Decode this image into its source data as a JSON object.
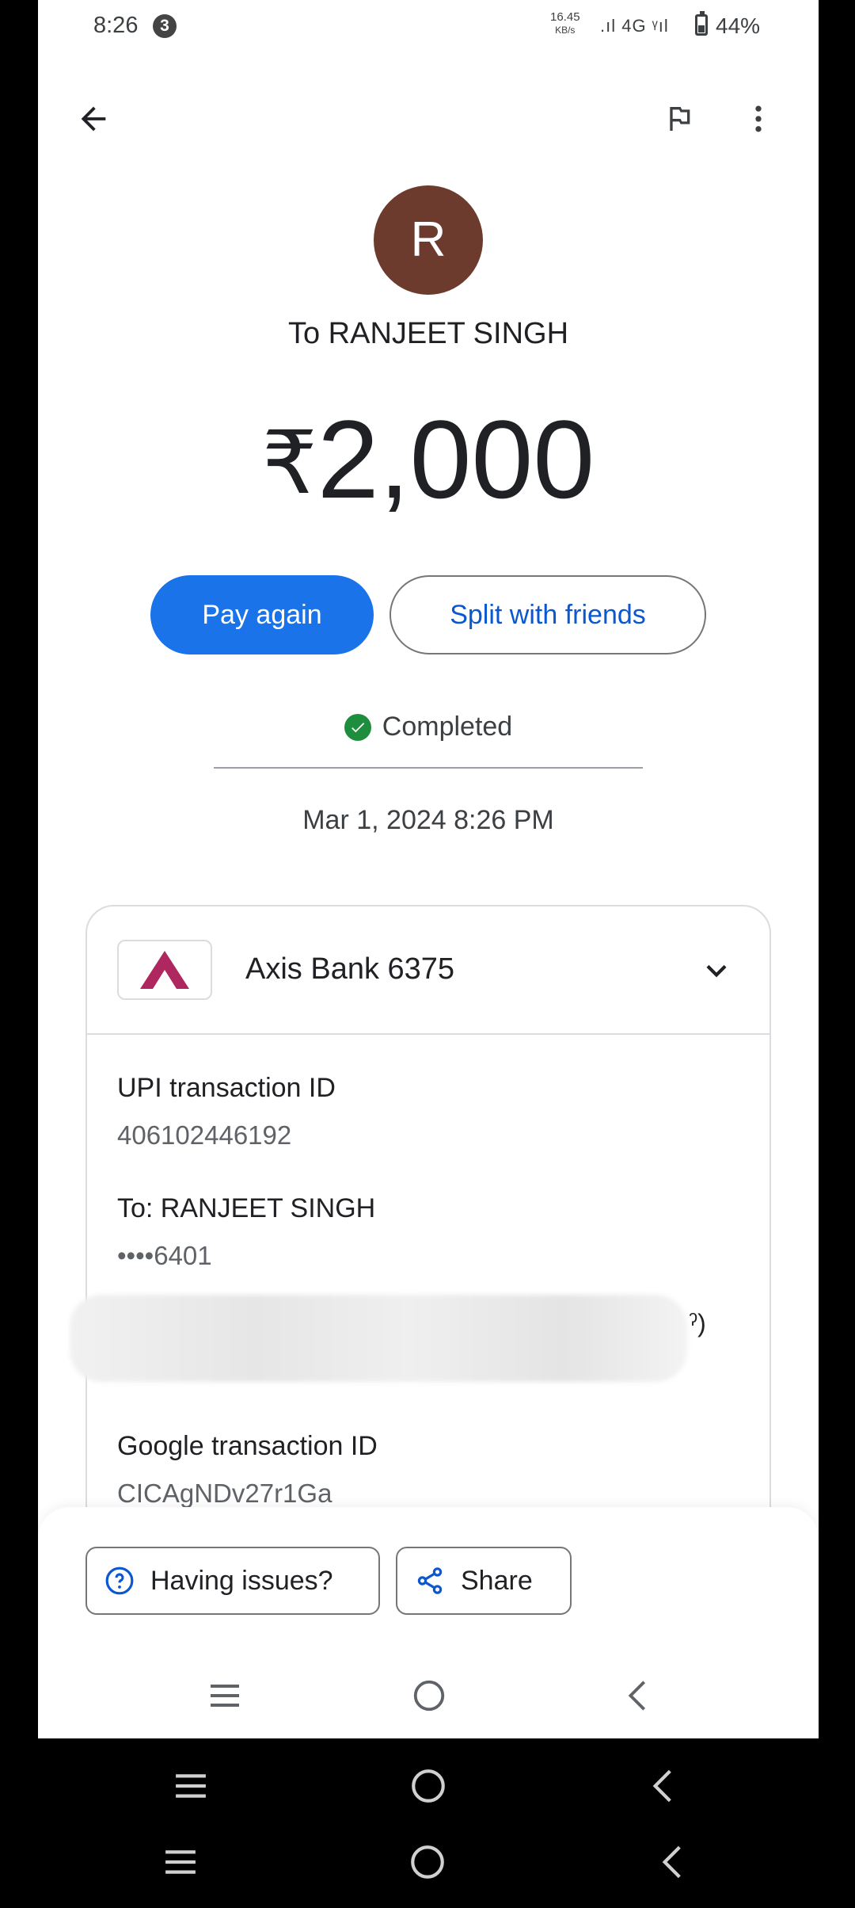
{
  "status_bar": {
    "time": "8:26",
    "notification_count": "3",
    "net_speed_value": "16.45",
    "net_speed_unit": "KB/s",
    "network": ".ıl 4G ᵞıl",
    "battery": "44%"
  },
  "transaction": {
    "avatar_letter": "R",
    "payee": "To RANJEET SINGH",
    "currency": "₹",
    "amount": "2,000",
    "pay_again_label": "Pay again",
    "split_label": "Split with friends",
    "status": "Completed",
    "datetime": "Mar 1, 2024 8:26 PM"
  },
  "card": {
    "bank_name": "Axis Bank 6375",
    "upi_label": "UPI transaction ID",
    "upi_value": "406102446192",
    "to_label": "To: RANJEET SINGH",
    "to_value": "••••6401",
    "hidden_tail": "ˀ)",
    "google_label": "Google transaction ID",
    "google_value": "CICAgNDv27r1Ga"
  },
  "actions": {
    "issues_label": "Having issues?",
    "share_label": "Share"
  },
  "colors": {
    "primary": "#1a73e8",
    "success": "#1e8e3e",
    "axis_brand": "#ae275f",
    "avatar": "#6d3b2e"
  }
}
